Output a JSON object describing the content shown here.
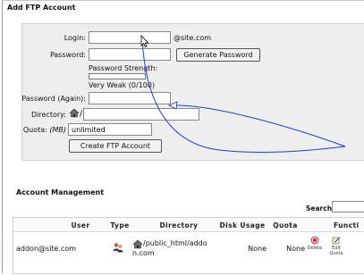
{
  "form": {
    "title": "Add FTP Account",
    "login_label": "Login:",
    "login_value": "",
    "domain_suffix": "@site.com",
    "password_label": "Password:",
    "password_value": "",
    "generate_label": "Generate Password",
    "strength_label": "Password Strength:",
    "strength_text": "Very Weak (0/100)",
    "strength_fraction": 0,
    "password_again_label": "Password (Again):",
    "password_again_value": "",
    "directory_label": "Directory:",
    "directory_value": "",
    "quota_label": "Quota: ",
    "quota_unit": "(MB)",
    "quota_value": "unlimited",
    "create_label": "Create FTP Account"
  },
  "management": {
    "title": "Account Management",
    "search_label": "Search",
    "search_value": "",
    "columns": [
      "User",
      "Type",
      "Directory",
      "Disk Usage",
      "Quota",
      "Functi"
    ],
    "rows": [
      {
        "user": "addon@site.com",
        "type_icon": "users-icon",
        "directory_line1": "/public_html/addo",
        "directory_line2": "n.com",
        "disk_usage": "None",
        "quota": "None",
        "actions": [
          "Delete",
          "Edit Quota"
        ]
      }
    ]
  },
  "colors": {
    "panel_bg": "#eeeeee",
    "annotation_arrow": "#1a3fd6"
  },
  "icons": [
    "home-icon",
    "users-icon",
    "delete-icon",
    "edit-quota-icon",
    "mouse-cursor-icon"
  ]
}
